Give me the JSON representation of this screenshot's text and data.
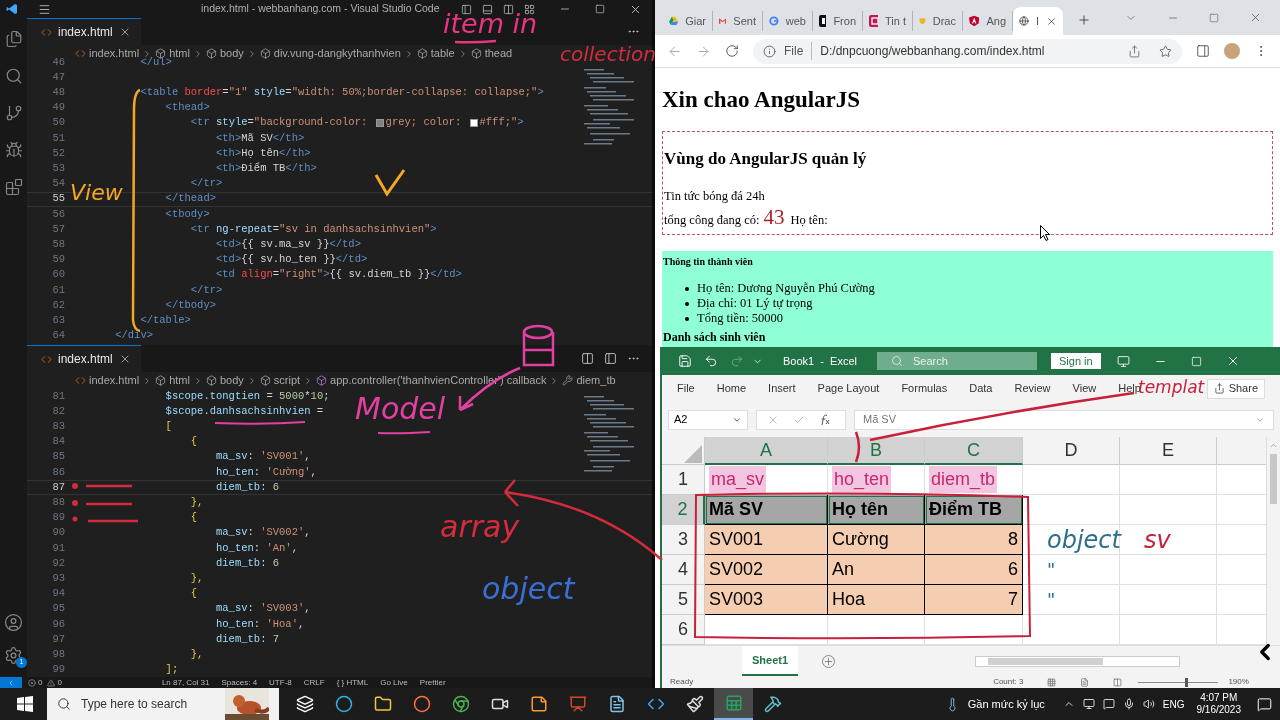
{
  "vscode": {
    "title": "index.html - webbanhang.com - Visual Studio Code",
    "groups": [
      {
        "tab": "index.html",
        "breadcrumb": [
          {
            "kind": "file",
            "text": "index.html"
          },
          {
            "kind": "element",
            "text": "html"
          },
          {
            "kind": "element",
            "text": "body"
          },
          {
            "kind": "element",
            "text": "div.vung-dangkythanhvien"
          },
          {
            "kind": "element",
            "text": "table"
          },
          {
            "kind": "element",
            "text": "thead"
          }
        ],
        "lines": [
          {
            "n": "46",
            "current": false,
            "tokens": [
              {
                "kind": "tag",
                "text": "        </ul>"
              }
            ]
          },
          {
            "n": "47",
            "current": false
          },
          {
            "n": "48",
            "current": false,
            "tokens": [
              {
                "kind": "tag",
                "text": "        <table"
              },
              {
                "kind": "invalid",
                "text": " border"
              },
              {
                "kind": "text",
                "text": "="
              },
              {
                "kind": "string",
                "text": "\"1\""
              },
              {
                "kind": "attr",
                "text": " style"
              },
              {
                "kind": "text",
                "text": "="
              },
              {
                "kind": "string",
                "text": "\"width: 50%;border-collapse: collapse;\""
              },
              {
                "kind": "tag",
                "text": ">"
              }
            ]
          },
          {
            "n": "49",
            "current": false,
            "tokens": [
              {
                "kind": "tag",
                "text": "            <thead>"
              }
            ]
          },
          {
            "n": "50",
            "current": false,
            "tokens": [
              {
                "kind": "tag",
                "text": "                <tr"
              },
              {
                "kind": "attr",
                "text": " style"
              },
              {
                "kind": "text",
                "text": "="
              },
              {
                "kind": "string",
                "text": "\"background-color: "
              },
              {
                "kind": "swatch",
                "color": "#808080"
              },
              {
                "kind": "string",
                "text": "grey; color: "
              },
              {
                "kind": "swatch",
                "color": "#ffffff"
              },
              {
                "kind": "string",
                "text": "#fff;\""
              },
              {
                "kind": "tag",
                "text": ">"
              }
            ]
          },
          {
            "n": "51",
            "current": false,
            "tokens": [
              {
                "kind": "tag",
                "text": "                    <th>"
              },
              {
                "kind": "text",
                "text": "Mã SV"
              },
              {
                "kind": "tag",
                "text": "</th>"
              }
            ]
          },
          {
            "n": "52",
            "current": false,
            "tokens": [
              {
                "kind": "tag",
                "text": "                    <th>"
              },
              {
                "kind": "text",
                "text": "Họ tên"
              },
              {
                "kind": "tag",
                "text": "</th>"
              }
            ]
          },
          {
            "n": "53",
            "current": false,
            "tokens": [
              {
                "kind": "tag",
                "text": "                    <th>"
              },
              {
                "kind": "text",
                "text": "Điểm TB"
              },
              {
                "kind": "tag",
                "text": "</th>"
              }
            ]
          },
          {
            "n": "54",
            "current": false,
            "tokens": [
              {
                "kind": "tag",
                "text": "                </tr>"
              }
            ]
          },
          {
            "n": "55",
            "current": true,
            "tokens": [
              {
                "kind": "tag",
                "text": "            </thead>"
              }
            ]
          },
          {
            "n": "56",
            "current": false,
            "tokens": [
              {
                "kind": "tag",
                "text": "            <tbody>"
              }
            ]
          },
          {
            "n": "57",
            "current": false,
            "tokens": [
              {
                "kind": "tag",
                "text": "                <tr"
              },
              {
                "kind": "attr",
                "text": " ng-repeat"
              },
              {
                "kind": "text",
                "text": "="
              },
              {
                "kind": "string",
                "text": "\"sv in danhsachsinhvien\""
              },
              {
                "kind": "tag",
                "text": ">"
              }
            ]
          },
          {
            "n": "58",
            "current": false,
            "tokens": [
              {
                "kind": "tag",
                "text": "                    <td>"
              },
              {
                "kind": "text",
                "text": "{{ sv.ma_sv }}"
              },
              {
                "kind": "tag",
                "text": "</td>"
              }
            ]
          },
          {
            "n": "59",
            "current": false,
            "tokens": [
              {
                "kind": "tag",
                "text": "                    <td>"
              },
              {
                "kind": "text",
                "text": "{{ sv.ho_ten }}"
              },
              {
                "kind": "tag",
                "text": "</td>"
              }
            ]
          },
          {
            "n": "60",
            "current": false,
            "tokens": [
              {
                "kind": "tag",
                "text": "                    <td"
              },
              {
                "kind": "invalid",
                "text": " align"
              },
              {
                "kind": "text",
                "text": "="
              },
              {
                "kind": "string",
                "text": "\"right\""
              },
              {
                "kind": "tag",
                "text": ">"
              },
              {
                "kind": "text",
                "text": "{{ sv.diem_tb }}"
              },
              {
                "kind": "tag",
                "text": "</td>"
              }
            ]
          },
          {
            "n": "61",
            "current": false,
            "tokens": [
              {
                "kind": "tag",
                "text": "                </tr>"
              }
            ]
          },
          {
            "n": "62",
            "current": false,
            "tokens": [
              {
                "kind": "tag",
                "text": "            </tbody>"
              }
            ]
          },
          {
            "n": "63",
            "current": false,
            "tokens": [
              {
                "kind": "tag",
                "text": "        </table>"
              }
            ]
          },
          {
            "n": "64",
            "current": false,
            "tokens": [
              {
                "kind": "tag",
                "text": "    </div>"
              }
            ]
          }
        ]
      },
      {
        "tab": "index.html",
        "breadcrumb": [
          {
            "kind": "file",
            "text": "index.html"
          },
          {
            "kind": "element",
            "text": "html"
          },
          {
            "kind": "element",
            "text": "body"
          },
          {
            "kind": "element",
            "text": "script"
          },
          {
            "kind": "function",
            "text": "app.controller('thanhvienController') callback"
          },
          {
            "kind": "property",
            "text": "diem_tb"
          }
        ],
        "lines": [
          {
            "n": "81",
            "current": false,
            "tokens": [
              {
                "kind": "var",
                "text": "            $scope.tongtien"
              },
              {
                "kind": "text",
                "text": " = "
              },
              {
                "kind": "number",
                "text": "5000"
              },
              {
                "kind": "text",
                "text": "*"
              },
              {
                "kind": "number",
                "text": "10"
              },
              {
                "kind": "text",
                "text": ";"
              }
            ]
          },
          {
            "n": "82",
            "current": false,
            "tokens": [
              {
                "kind": "var",
                "text": "            $scope.danhsachsinhvien"
              },
              {
                "kind": "text",
                "text": " ="
              }
            ]
          },
          {
            "n": "83",
            "current": false,
            "tokens": [
              {
                "kind": "brace",
                "text": "            ["
              }
            ]
          },
          {
            "n": "84",
            "current": false,
            "tokens": [
              {
                "kind": "brace",
                "text": "                {"
              }
            ]
          },
          {
            "n": "85",
            "current": false,
            "tokens": [
              {
                "kind": "var",
                "text": "                    ma_sv"
              },
              {
                "kind": "text",
                "text": ": "
              },
              {
                "kind": "string",
                "text": "'SV001'"
              },
              {
                "kind": "text",
                "text": ","
              }
            ]
          },
          {
            "n": "86",
            "current": false,
            "tokens": [
              {
                "kind": "var",
                "text": "                    ho_ten"
              },
              {
                "kind": "text",
                "text": ": "
              },
              {
                "kind": "string",
                "text": "'Cường'"
              },
              {
                "kind": "text",
                "text": ","
              }
            ]
          },
          {
            "n": "87",
            "current": true,
            "tokens": [
              {
                "kind": "var",
                "text": "                    diem_tb"
              },
              {
                "kind": "text",
                "text": ": "
              },
              {
                "kind": "number",
                "text": "6"
              }
            ]
          },
          {
            "n": "88",
            "current": false,
            "tokens": [
              {
                "kind": "brace",
                "text": "                },"
              }
            ]
          },
          {
            "n": "89",
            "current": false,
            "tokens": [
              {
                "kind": "brace",
                "text": "                {"
              }
            ]
          },
          {
            "n": "90",
            "current": false,
            "tokens": [
              {
                "kind": "var",
                "text": "                    ma_sv"
              },
              {
                "kind": "text",
                "text": ": "
              },
              {
                "kind": "string",
                "text": "'SV002'"
              },
              {
                "kind": "text",
                "text": ","
              }
            ]
          },
          {
            "n": "91",
            "current": false,
            "tokens": [
              {
                "kind": "var",
                "text": "                    ho_ten"
              },
              {
                "kind": "text",
                "text": ": "
              },
              {
                "kind": "string",
                "text": "'An'"
              },
              {
                "kind": "text",
                "text": ","
              }
            ]
          },
          {
            "n": "92",
            "current": false,
            "tokens": [
              {
                "kind": "var",
                "text": "                    diem_tb"
              },
              {
                "kind": "text",
                "text": ": "
              },
              {
                "kind": "number",
                "text": "6"
              }
            ]
          },
          {
            "n": "93",
            "current": false,
            "tokens": [
              {
                "kind": "brace",
                "text": "                },"
              }
            ]
          },
          {
            "n": "94",
            "current": false,
            "tokens": [
              {
                "kind": "brace",
                "text": "                {"
              }
            ]
          },
          {
            "n": "95",
            "current": false,
            "tokens": [
              {
                "kind": "var",
                "text": "                    ma_sv"
              },
              {
                "kind": "text",
                "text": ": "
              },
              {
                "kind": "string",
                "text": "'SV003'"
              },
              {
                "kind": "text",
                "text": ","
              }
            ]
          },
          {
            "n": "96",
            "current": false,
            "tokens": [
              {
                "kind": "var",
                "text": "                    ho_ten"
              },
              {
                "kind": "text",
                "text": ": "
              },
              {
                "kind": "string",
                "text": "'Hoa'"
              },
              {
                "kind": "text",
                "text": ","
              }
            ]
          },
          {
            "n": "97",
            "current": false,
            "tokens": [
              {
                "kind": "var",
                "text": "                    diem_tb"
              },
              {
                "kind": "text",
                "text": ": "
              },
              {
                "kind": "number",
                "text": "7"
              }
            ]
          },
          {
            "n": "98",
            "current": false,
            "tokens": [
              {
                "kind": "brace",
                "text": "                },"
              }
            ]
          },
          {
            "n": "99",
            "current": false,
            "tokens": [
              {
                "kind": "brace",
                "text": "            ];"
              }
            ]
          }
        ]
      }
    ],
    "settings_badge": "1",
    "status": {
      "errors": "0",
      "warnings": "0",
      "items": [
        "Ln 87, Col 31",
        "Spaces: 4",
        "UTF-8",
        "CRLF",
        "{ } HTML",
        "Go Live",
        "Prettier"
      ]
    }
  },
  "browser": {
    "tabs": [
      {
        "title": "Giar",
        "selected": false
      },
      {
        "title": "Sent",
        "selected": false
      },
      {
        "title": "web",
        "selected": false
      },
      {
        "title": "Fron",
        "selected": false
      },
      {
        "title": "Tin t",
        "selected": false
      },
      {
        "title": "Drac",
        "selected": false
      },
      {
        "title": "Ang",
        "selected": false
      },
      {
        "title": "I",
        "selected": true
      }
    ],
    "address_scheme": "File",
    "url": "D:/dnpcuong/webbanhang.com/index.html",
    "page": {
      "heading": "Xin chao AngularJS",
      "region_heading": "Vùng do AngularJS quản lý",
      "news": "Tin tức bóng đá 24h",
      "count_label": "tổng công đang có:",
      "count": "43",
      "name_label": "Họ tên:",
      "member_heading": "Thông tin thành viên",
      "member_items": [
        "Họ tên: Dương Nguyễn Phú Cường",
        "Địa chỉ: 01 Lý tự trọng",
        "Tổng tiền: 50000"
      ],
      "list_heading": "Danh sách sinh viên"
    }
  },
  "excel": {
    "title": "Book1  -  Excel",
    "search_placeholder": "Search",
    "sign_in": "Sign in",
    "ribbon": [
      "File",
      "Home",
      "Insert",
      "Page Layout",
      "Formulas",
      "Data",
      "Review",
      "View",
      "Help"
    ],
    "share": "Share",
    "name_box": "A2",
    "formula": "Mã SV",
    "columns": [
      {
        "label": "A",
        "selected": true
      },
      {
        "label": "B",
        "selected": true
      },
      {
        "label": "C",
        "selected": true
      },
      {
        "label": "D",
        "selected": false
      },
      {
        "label": "E",
        "selected": false
      }
    ],
    "rows": [
      {
        "n": "1",
        "kind": "field_names",
        "selected": false,
        "cells": [
          {
            "text": "ma_sv",
            "selected": false
          },
          {
            "text": "ho_ten",
            "selected": false
          },
          {
            "text": "diem_tb",
            "selected": false
          }
        ]
      },
      {
        "n": "2",
        "kind": "header",
        "selected": true,
        "cells": [
          {
            "text": "Mã SV",
            "selected": true
          },
          {
            "text": "Họ tên",
            "selected": true
          },
          {
            "text": "Điểm TB",
            "selected": true
          }
        ]
      },
      {
        "n": "3",
        "kind": "data",
        "selected": false,
        "cells": [
          {
            "text": "SV001",
            "selected": false
          },
          {
            "text": "Cường",
            "selected": false
          },
          {
            "text": "8",
            "selected": false
          }
        ]
      },
      {
        "n": "4",
        "kind": "data",
        "selected": false,
        "cells": [
          {
            "text": "SV002",
            "selected": false
          },
          {
            "text": "An",
            "selected": false
          },
          {
            "text": "6",
            "selected": false
          }
        ]
      },
      {
        "n": "5",
        "kind": "data",
        "selected": false,
        "cells": [
          {
            "text": "SV003",
            "selected": false
          },
          {
            "text": "Hoa",
            "selected": false
          },
          {
            "text": "7",
            "selected": false
          }
        ]
      },
      {
        "n": "6",
        "kind": "empty",
        "selected": false
      }
    ],
    "sheet_tab": "Sheet1",
    "status": "Ready",
    "count": "Count: 3",
    "zoom_slider": {
      "level": 0.6
    },
    "zoom": "190%"
  },
  "annotations": [
    {
      "text": "item in",
      "color": "#e8357f"
    },
    {
      "text": "collection",
      "color": "#d42c3c"
    },
    {
      "text": "View",
      "color": "#f5a623"
    },
    {
      "text": "Model",
      "color": "#e040a0"
    },
    {
      "text": "array",
      "color": "#d42c3c"
    },
    {
      "text": "object",
      "color": "#3b6fd6"
    },
    {
      "text": "templat",
      "color": "#c8203a"
    },
    {
      "text": "object",
      "color": "#2d6f8a"
    },
    {
      "text": "sv",
      "color": "#c8203a"
    },
    {
      "text": "\"",
      "color": "#2d6f8a"
    },
    {
      "text": "\"",
      "color": "#2d6f8a"
    }
  ],
  "taskbar": {
    "search_placeholder": "Type here to search",
    "apps": [
      {
        "kind": "taskview",
        "active": false
      },
      {
        "kind": "edge",
        "active": false
      },
      {
        "kind": "folder",
        "active": false
      },
      {
        "kind": "firefox",
        "active": false
      },
      {
        "kind": "chrome",
        "active": false
      },
      {
        "kind": "recorder",
        "active": false
      },
      {
        "kind": "orange",
        "active": false
      },
      {
        "kind": "slides",
        "active": false
      },
      {
        "kind": "notes",
        "active": false
      },
      {
        "kind": "code",
        "active": false
      },
      {
        "kind": "paint",
        "active": false
      },
      {
        "kind": "sheet",
        "active": true
      },
      {
        "kind": "tool",
        "active": false
      }
    ],
    "weather": "Gần mức kỷ lục",
    "language": "ENG",
    "time": "4:07 PM",
    "date": "9/16/2023"
  }
}
